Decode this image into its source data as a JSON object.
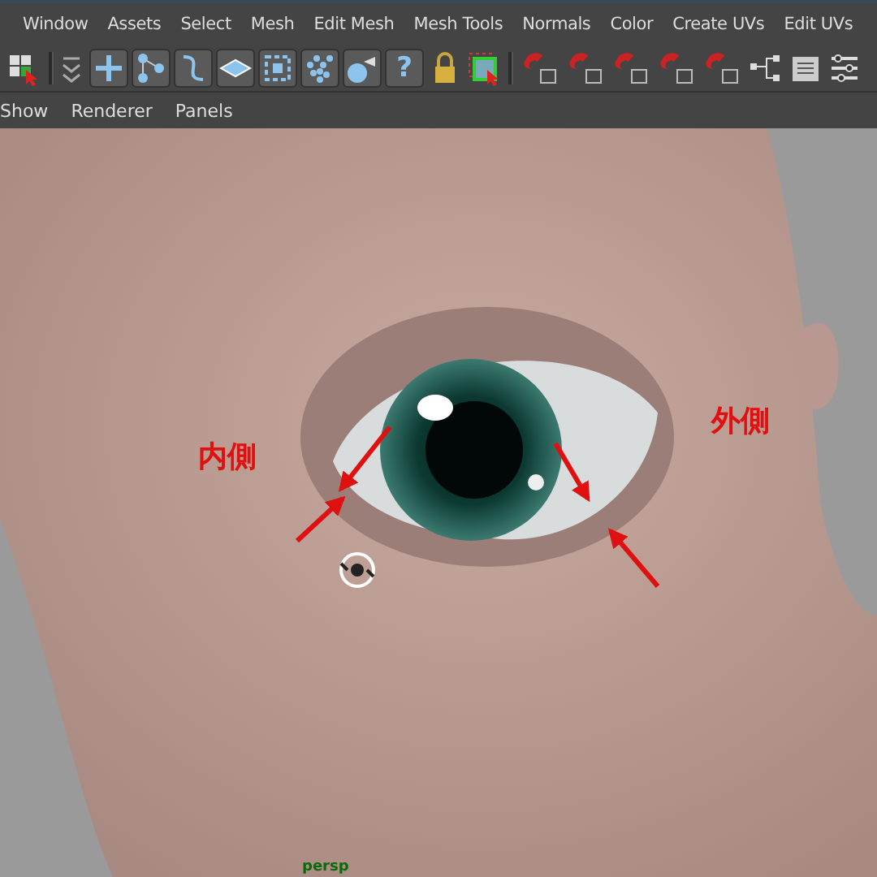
{
  "menu_bar": {
    "items": [
      "Window",
      "Assets",
      "Select",
      "Mesh",
      "Edit Mesh",
      "Mesh Tools",
      "Normals",
      "Color",
      "Create UVs",
      "Edit UVs"
    ]
  },
  "toolbar": {
    "help_glyph": "?"
  },
  "panel_menu": {
    "items": [
      "Show",
      "Renderer",
      "Panels"
    ]
  },
  "viewport": {
    "annotations": [
      {
        "text": "内側"
      },
      {
        "text": "外側"
      }
    ],
    "camera_label": "persp"
  }
}
